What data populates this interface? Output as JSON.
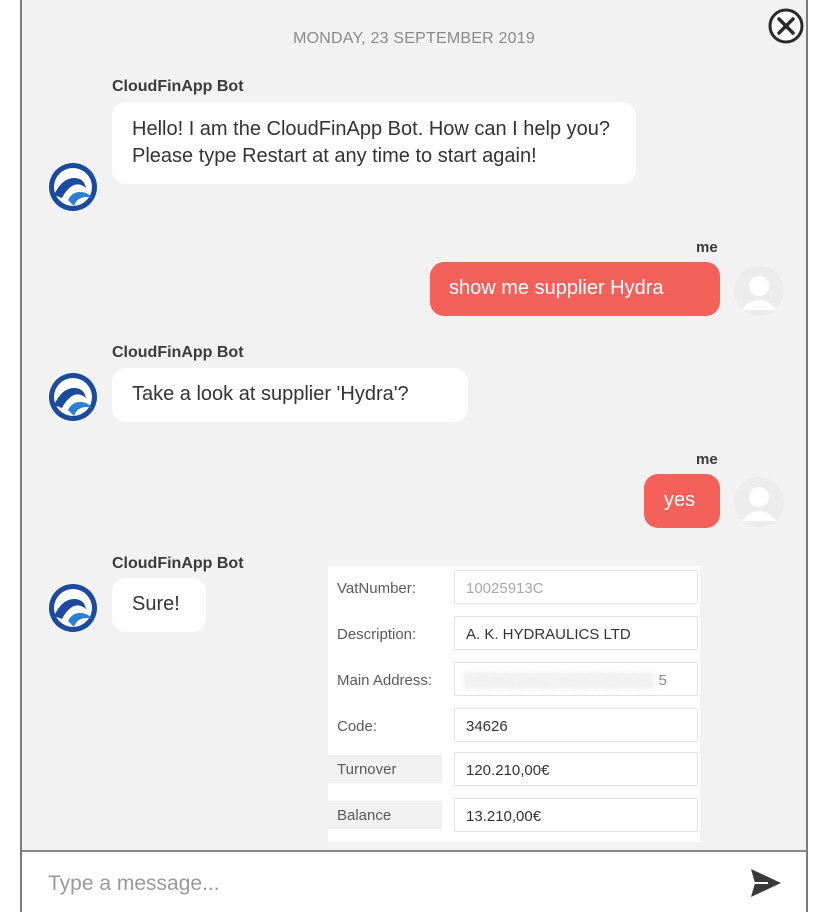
{
  "chat": {
    "date": "MONDAY, 23 SEPTEMBER 2019",
    "bot_name": "CloudFinApp Bot",
    "user_name": "me",
    "messages": [
      {
        "from": "bot",
        "text": "Hello! I am the CloudFinApp Bot. How can I help you? Please type Restart at any time to start again!"
      },
      {
        "from": "user",
        "text": "show me supplier Hydra"
      },
      {
        "from": "bot",
        "text": "Take a look at supplier 'Hydra'?"
      },
      {
        "from": "user",
        "text": "yes"
      },
      {
        "from": "bot",
        "text": "Sure!"
      }
    ]
  },
  "supplier_card": {
    "fields": [
      {
        "label": "VatNumber:",
        "value": "10025913C"
      },
      {
        "label": "Description:",
        "value": "A. K. HYDRAULICS LTD"
      },
      {
        "label": "Main Address:",
        "value": "5"
      },
      {
        "label": "Code:",
        "value": "34626"
      },
      {
        "label": "Turnover",
        "value": "120.210,00€"
      },
      {
        "label": "Balance",
        "value": "13.210,00€"
      }
    ]
  },
  "composer": {
    "placeholder": "Type a message..."
  },
  "icons": {
    "close": "close-circle-icon",
    "send": "send-icon",
    "bot_avatar": "cloudfinapp-logo-icon",
    "user_avatar": "user-avatar-icon"
  },
  "colors": {
    "user_bubble": "#f4615b",
    "bot_bubble": "#ffffff",
    "background": "#f2f2f2",
    "bot_avatar": "#1c4a9c"
  }
}
